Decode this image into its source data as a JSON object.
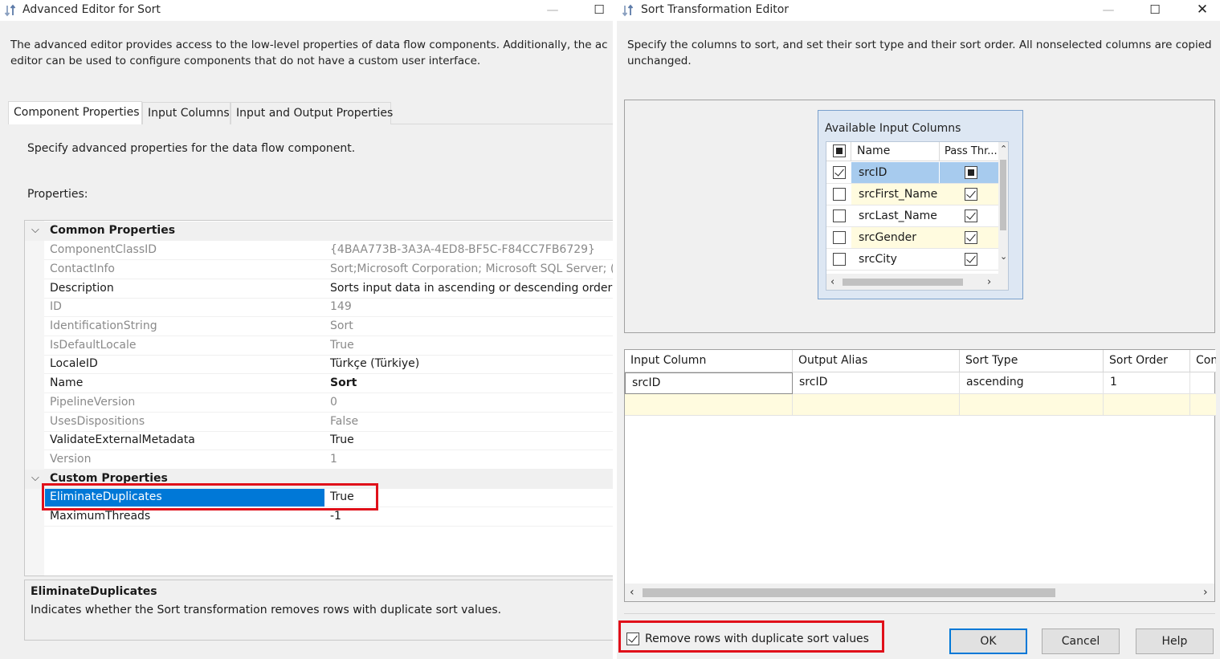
{
  "left": {
    "title": "Advanced Editor for Sort",
    "intro_line1": "The advanced editor provides access to the low-level properties of data flow components. Additionally, the ac",
    "intro_line2": "editor can be used to configure components that do not have a custom user interface.",
    "tabs": [
      "Component Properties",
      "Input Columns",
      "Input and Output Properties"
    ],
    "instruction": "Specify advanced properties for the data flow component.",
    "properties_label": "Properties:",
    "categories": {
      "common": "Common Properties",
      "custom": "Custom Properties"
    },
    "common_properties": [
      {
        "name": "ComponentClassID",
        "value": "{4BAA773B-3A3A-4ED8-BF5C-F84CC7FB6729}"
      },
      {
        "name": "ContactInfo",
        "value": "Sort;Microsoft Corporation; Microsoft SQL Server; (C"
      },
      {
        "name": "Description",
        "value": "Sorts input data in ascending or descending order w"
      },
      {
        "name": "ID",
        "value": "149"
      },
      {
        "name": "IdentificationString",
        "value": "Sort"
      },
      {
        "name": "IsDefaultLocale",
        "value": "True"
      },
      {
        "name": "LocaleID",
        "value": "Türkçe (Türkiye)"
      },
      {
        "name": "Name",
        "value": "Sort"
      },
      {
        "name": "PipelineVersion",
        "value": "0"
      },
      {
        "name": "UsesDispositions",
        "value": "False"
      },
      {
        "name": "ValidateExternalMetadata",
        "value": "True"
      },
      {
        "name": "Version",
        "value": "1"
      }
    ],
    "custom_properties": [
      {
        "name": "EliminateDuplicates",
        "value": "True"
      },
      {
        "name": "MaximumThreads",
        "value": "-1"
      }
    ],
    "description_title": "EliminateDuplicates",
    "description_text": "Indicates whether the Sort transformation removes rows with duplicate sort values."
  },
  "right": {
    "title": "Sort Transformation Editor",
    "intro": "Specify the columns to sort, and set their sort type and their sort order. All nonselected columns are copied unchanged.",
    "available_title": "Available Input Columns",
    "available_headers": {
      "name": "Name",
      "pass": "Pass Thr..."
    },
    "available_columns": [
      {
        "name": "srcID"
      },
      {
        "name": "srcFirst_Name"
      },
      {
        "name": "srcLast_Name"
      },
      {
        "name": "srcGender"
      },
      {
        "name": "srcCity"
      }
    ],
    "sort_headers": [
      "Input Column",
      "Output Alias",
      "Sort Type",
      "Sort Order",
      "Con"
    ],
    "sort_rows": [
      {
        "input": "srcID",
        "alias": "srcID",
        "type": "ascending",
        "order": "1"
      }
    ],
    "remove_duplicates_label": "Remove rows with duplicate sort values",
    "buttons": {
      "ok": "OK",
      "cancel": "Cancel",
      "help": "Help"
    }
  },
  "colors": {
    "selection": "#0078d7",
    "highlight_box": "#e0101a",
    "row_highlight": "#fffbdf",
    "available_box": "#dde7f3"
  }
}
